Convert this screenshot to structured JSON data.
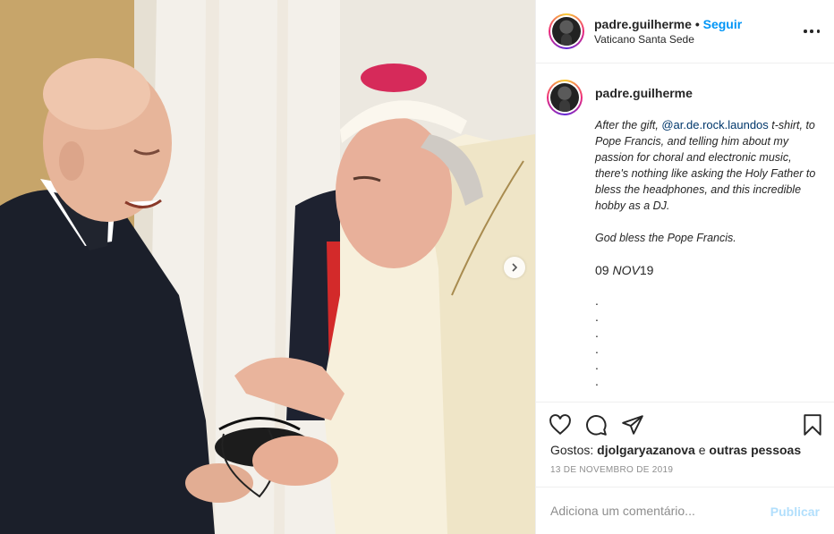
{
  "post": {
    "username": "padre.guilherme",
    "separator": "•",
    "follow_label": "Seguir",
    "location": "Vaticano Santa Sede"
  },
  "caption": {
    "username": "padre.guilherme",
    "text_before": "After the gift, ",
    "mention": "@ar.de.rock.laundos",
    "text_after": " t-shirt, to Pope Francis, and telling him about my passion for choral and electronic music, there's nothing like asking the Holy Father to bless the headphones, and this incredible hobby as a DJ.",
    "blessing": "God bless the Pope Francis.",
    "date_day": "09 ",
    "date_month": "NOV",
    "date_year": "19",
    "dots": [
      ".",
      ".",
      ".",
      ".",
      ".",
      "."
    ]
  },
  "likes": {
    "prefix": "Gostos: ",
    "user": "djolgaryazanova",
    "connector": " e ",
    "others": "outras pessoas"
  },
  "post_date": "13 DE NOVEMBRO DE 2019",
  "comment": {
    "placeholder": "Adiciona um comentário...",
    "publish_label": "Publicar"
  },
  "icons": {
    "like": "heart-icon",
    "comment": "comment-icon",
    "share": "share-icon",
    "save": "bookmark-icon",
    "more": "more-options-icon",
    "next": "chevron-right-icon"
  },
  "colors": {
    "accent": "#0095f6",
    "publish_disabled": "#b2dffc",
    "secondary_text": "#8e8e8e",
    "mention": "#00376b"
  }
}
